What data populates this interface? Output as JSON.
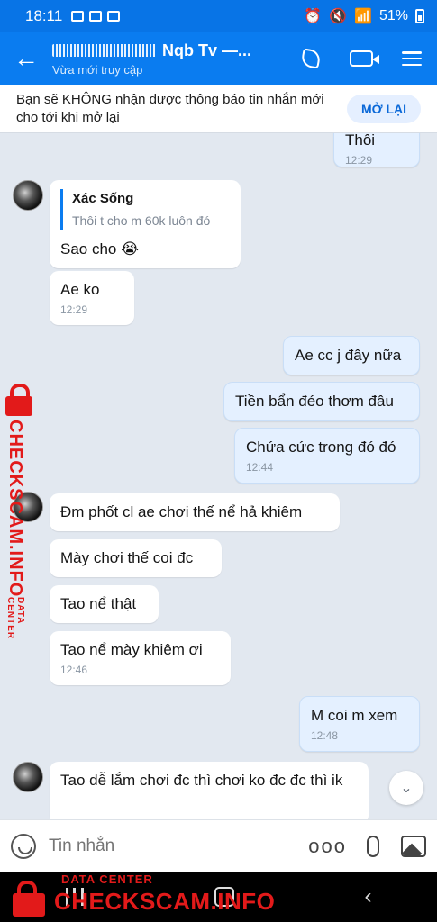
{
  "status_bar": {
    "time": "18:11",
    "battery": "51%"
  },
  "header": {
    "title": "Nqb Tv —...",
    "subtitle": "Vừa mới truy cập",
    "icons": [
      "back-arrow",
      "phone",
      "video-camera",
      "menu"
    ]
  },
  "notice": {
    "text": "Bạn sẽ KHÔNG nhận được thông báo tin nhắn mới cho tới khi mở lại",
    "button": "MỞ LẠI"
  },
  "messages": [
    {
      "id": "m0",
      "side": "right",
      "text": "Thôi",
      "time": "12:29"
    },
    {
      "id": "m1",
      "side": "left",
      "quote_name": "Xác Sống",
      "quote_text": "Thôi t cho m 60k luôn đó",
      "text": "Sao cho 😭"
    },
    {
      "id": "m2",
      "side": "left",
      "text": "Ae ko",
      "time": "12:29"
    },
    {
      "id": "m3",
      "side": "right",
      "text": "Ae cc j đây nữa"
    },
    {
      "id": "m4",
      "side": "right",
      "text": "Tiền bẩn đéo thơm đâu"
    },
    {
      "id": "m5",
      "side": "right",
      "text": "Chứa cức trong đó đó",
      "time": "12:44"
    },
    {
      "id": "m6",
      "side": "left",
      "text": "Đm phốt cl ae chơi thế nể hả khiêm"
    },
    {
      "id": "m7",
      "side": "left",
      "text": "Mày chơi thế coi đc"
    },
    {
      "id": "m8",
      "side": "left",
      "text": "Tao nể thật"
    },
    {
      "id": "m9",
      "side": "left",
      "text": "Tao nể mày khiêm ơi",
      "time": "12:46"
    },
    {
      "id": "m10",
      "side": "right",
      "text": "M coi m xem",
      "time": "12:48"
    },
    {
      "id": "m11",
      "side": "left",
      "text": "Tao dễ lắm chơi đc thì chơi ko đc đc thì ik"
    }
  ],
  "input": {
    "placeholder": "Tin nhắn",
    "more": "ooo"
  },
  "watermark": {
    "small": "DATA CENTER",
    "big": "CHECKSCAM.INFO"
  },
  "colors": {
    "header": "#0a7cf0",
    "status_bar": "#0874e6",
    "chat_bg": "#e2e8f0",
    "my_bubble": "#e4f0ff",
    "watermark": "#e21a1a"
  }
}
